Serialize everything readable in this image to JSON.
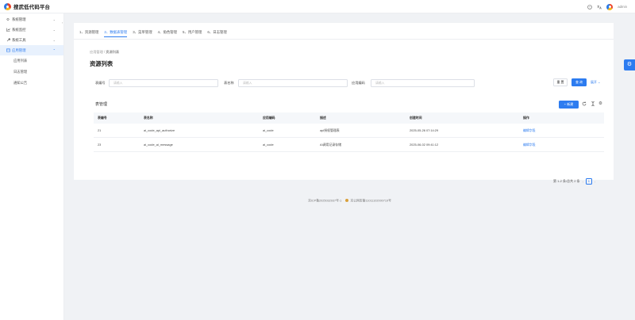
{
  "app": {
    "title": "搜武低代码平台",
    "username": "admin"
  },
  "sidebar": {
    "items": [
      {
        "label": "系统管理",
        "icon": "gear-icon",
        "expanded": false
      },
      {
        "label": "系统监控",
        "icon": "chart-icon",
        "expanded": false
      },
      {
        "label": "系统工具",
        "icon": "wrench-icon",
        "expanded": false
      },
      {
        "label": "应用管理",
        "icon": "app-icon",
        "expanded": true,
        "active": true
      }
    ],
    "subitems": [
      "应用列表",
      "日志管理",
      "通知公告"
    ]
  },
  "steps": [
    {
      "label": "1、资源管理",
      "active": false
    },
    {
      "label": "2、数据表管理",
      "active": true
    },
    {
      "label": "3、菜单管理",
      "active": false
    },
    {
      "label": "4、角色管理",
      "active": false
    },
    {
      "label": "5、用户管理",
      "active": false
    },
    {
      "label": "6、日志管理",
      "active": false
    }
  ],
  "breadcrumb": {
    "parent": "应用管理",
    "separator": "/",
    "current": "资源列表"
  },
  "page_title": "资源列表",
  "filters": {
    "table_no_label": "表编号",
    "table_no_placeholder": "请输入",
    "table_name_label": "表名称",
    "table_name_placeholder": "请输入",
    "app_code_label": "应用编码",
    "app_code_placeholder": "请输入",
    "reset_label": "重 置",
    "search_label": "查 询",
    "expand_label": "展开"
  },
  "table": {
    "title": "表管理",
    "new_button": "+ 新建",
    "columns": [
      "表编号",
      "表名称",
      "应用编码",
      "描述",
      "创建时间",
      "操作"
    ],
    "rows": [
      {
        "id": "21",
        "name": "ai_code_api_authorize",
        "app_code": "ai_code",
        "desc": "api授权管理表",
        "created": "2025-05-26 07:14:29",
        "action": "编辑字段"
      },
      {
        "id": "23",
        "name": "ai_code_ai_message",
        "app_code": "ai_code",
        "desc": "AI调用记录存储",
        "created": "2025-06-02 09:41:12",
        "action": "编辑字段"
      }
    ]
  },
  "pagination": {
    "summary": "第 1-2 条/总共 2 条",
    "current_page": "1"
  },
  "footer": {
    "icp": "京ICP备2025032937号-1",
    "police": "京公网安备11011102000719号"
  },
  "colors": {
    "accent": "#2d7cf0"
  }
}
